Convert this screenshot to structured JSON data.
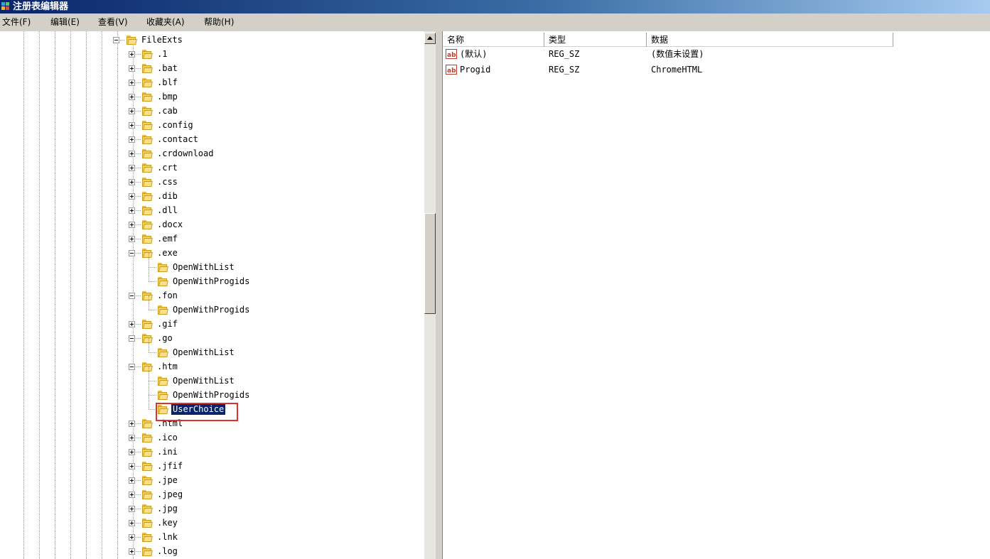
{
  "window": {
    "title": "注册表编辑器",
    "icon": "regedit-icon"
  },
  "menu": [
    {
      "label": "文件(F)"
    },
    {
      "label": "编辑(E)"
    },
    {
      "label": "查看(V)"
    },
    {
      "label": "收藏夹(A)"
    },
    {
      "label": "帮助(H)"
    }
  ],
  "tree": {
    "root": {
      "label": "FileExts",
      "expanded": true
    },
    "items": [
      {
        "label": ".1",
        "level": 1,
        "state": "collapsed"
      },
      {
        "label": ".bat",
        "level": 1,
        "state": "collapsed"
      },
      {
        "label": ".blf",
        "level": 1,
        "state": "collapsed"
      },
      {
        "label": ".bmp",
        "level": 1,
        "state": "collapsed"
      },
      {
        "label": ".cab",
        "level": 1,
        "state": "collapsed"
      },
      {
        "label": ".config",
        "level": 1,
        "state": "collapsed"
      },
      {
        "label": ".contact",
        "level": 1,
        "state": "collapsed"
      },
      {
        "label": ".crdownload",
        "level": 1,
        "state": "collapsed"
      },
      {
        "label": ".crt",
        "level": 1,
        "state": "collapsed"
      },
      {
        "label": ".css",
        "level": 1,
        "state": "collapsed"
      },
      {
        "label": ".dib",
        "level": 1,
        "state": "collapsed"
      },
      {
        "label": ".dll",
        "level": 1,
        "state": "collapsed"
      },
      {
        "label": ".docx",
        "level": 1,
        "state": "collapsed"
      },
      {
        "label": ".emf",
        "level": 1,
        "state": "collapsed"
      },
      {
        "label": ".exe",
        "level": 1,
        "state": "expanded"
      },
      {
        "label": "OpenWithList",
        "level": 2,
        "state": "leaf"
      },
      {
        "label": "OpenWithProgids",
        "level": 2,
        "state": "leaf"
      },
      {
        "label": ".fon",
        "level": 1,
        "state": "expanded"
      },
      {
        "label": "OpenWithProgids",
        "level": 2,
        "state": "leaf"
      },
      {
        "label": ".gif",
        "level": 1,
        "state": "collapsed"
      },
      {
        "label": ".go",
        "level": 1,
        "state": "expanded"
      },
      {
        "label": "OpenWithList",
        "level": 2,
        "state": "leaf"
      },
      {
        "label": ".htm",
        "level": 1,
        "state": "expanded"
      },
      {
        "label": "OpenWithList",
        "level": 2,
        "state": "leaf"
      },
      {
        "label": "OpenWithProgids",
        "level": 2,
        "state": "leaf"
      },
      {
        "label": "UserChoice",
        "level": 2,
        "state": "leaf",
        "selected": true
      },
      {
        "label": ".html",
        "level": 1,
        "state": "collapsed"
      },
      {
        "label": ".ico",
        "level": 1,
        "state": "collapsed"
      },
      {
        "label": ".ini",
        "level": 1,
        "state": "collapsed"
      },
      {
        "label": ".jfif",
        "level": 1,
        "state": "collapsed"
      },
      {
        "label": ".jpe",
        "level": 1,
        "state": "collapsed"
      },
      {
        "label": ".jpeg",
        "level": 1,
        "state": "collapsed"
      },
      {
        "label": ".jpg",
        "level": 1,
        "state": "collapsed"
      },
      {
        "label": ".key",
        "level": 1,
        "state": "collapsed"
      },
      {
        "label": ".lnk",
        "level": 1,
        "state": "collapsed"
      },
      {
        "label": ".log",
        "level": 1,
        "state": "collapsed"
      }
    ]
  },
  "values": {
    "columns": [
      "名称",
      "类型",
      "数据"
    ],
    "rows": [
      {
        "name": "(默认)",
        "type": "REG_SZ",
        "data": "(数值未设置)",
        "icon": "string-value-icon"
      },
      {
        "name": "Progid",
        "type": "REG_SZ",
        "data": "ChromeHTML",
        "icon": "string-value-icon"
      }
    ]
  },
  "colors": {
    "selection": "#0a246a",
    "highlight_box": "#e0302a",
    "titlebar_start": "#0a246a",
    "titlebar_end": "#a6caf0"
  }
}
